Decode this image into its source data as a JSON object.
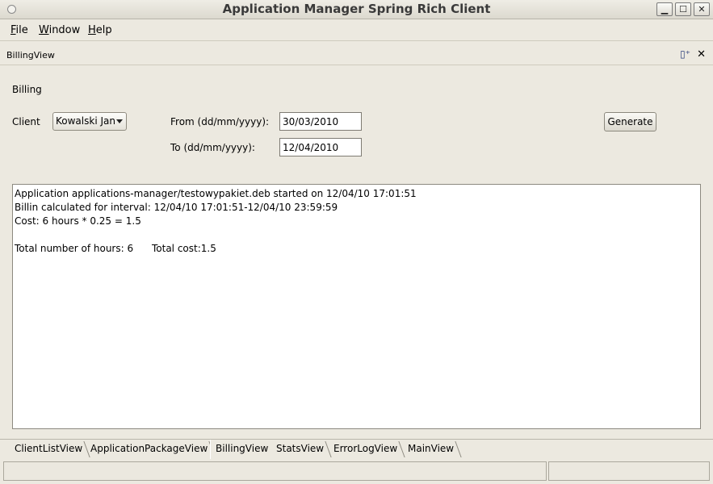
{
  "window": {
    "title": "Application Manager Spring Rich Client",
    "controls": {
      "minimize": "▁",
      "maximize": "☐",
      "close": "✕"
    }
  },
  "menu": {
    "file": {
      "mnemonic": "F",
      "rest": "ile"
    },
    "window": {
      "mnemonic": "W",
      "rest": "indow"
    },
    "help": {
      "mnemonic": "H",
      "rest": "elp"
    }
  },
  "view": {
    "title": "BillingView",
    "pin_icon": "▯⁺",
    "close_icon": "✕"
  },
  "billing": {
    "section_label": "Billing",
    "client_label": "Client",
    "client_value": "Kowalski Jan",
    "from_label": "From (dd/mm/yyyy):",
    "from_value": "30/03/2010",
    "to_label": "To (dd/mm/yyyy):",
    "to_value": "12/04/2010",
    "generate_label": "Generate"
  },
  "output": {
    "lines": [
      "Application applications-manager/testowypakiet.deb started on 12/04/10 17:01:51",
      "Billin calculated for interval: 12/04/10 17:01:51-12/04/10 23:59:59",
      "Cost: 6 hours * 0.25 = 1.5",
      "",
      "Total number of hours: 6      Total cost:1.5"
    ]
  },
  "tabs": [
    {
      "label": "ClientListView",
      "active": false
    },
    {
      "label": "ApplicationPackageView",
      "active": false
    },
    {
      "label": "BillingView",
      "active": true
    },
    {
      "label": "StatsView",
      "active": false
    },
    {
      "label": "ErrorLogView",
      "active": false
    },
    {
      "label": "MainView",
      "active": false
    }
  ]
}
